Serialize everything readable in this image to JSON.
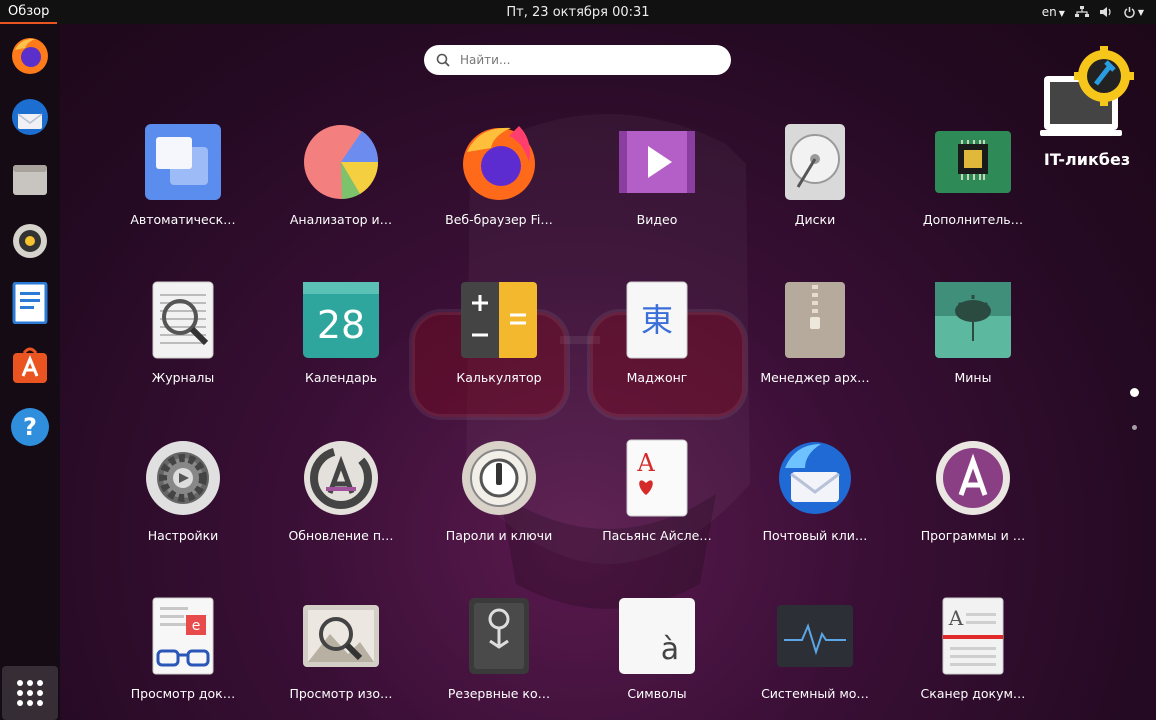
{
  "topbar": {
    "activities": "Обзор",
    "clock": "Пт, 23 октября  00:31",
    "lang": "en",
    "tray_icons": [
      "network-icon",
      "volume-icon",
      "power-icon"
    ]
  },
  "search": {
    "placeholder": "Найти..."
  },
  "dock": {
    "items": [
      "firefox-icon",
      "thunderbird-icon",
      "files-icon",
      "rhythmbox-icon",
      "writer-icon",
      "software-icon",
      "help-icon"
    ],
    "show_apps": "show-apps-grid-icon"
  },
  "apps": [
    {
      "label": "Автоматическ…",
      "icon": "automation-icon"
    },
    {
      "label": "Анализатор и…",
      "icon": "disk-usage-pie-icon"
    },
    {
      "label": "Веб-браузер Fi…",
      "icon": "firefox-icon"
    },
    {
      "label": "Видео",
      "icon": "video-play-icon"
    },
    {
      "label": "Диски",
      "icon": "disks-icon"
    },
    {
      "label": "Дополнитель…",
      "icon": "chip-icon"
    },
    {
      "label": "Журналы",
      "icon": "logs-magnifier-icon"
    },
    {
      "label": "Календарь",
      "icon": "calendar-icon",
      "day": "28"
    },
    {
      "label": "Калькулятор",
      "icon": "calculator-icon"
    },
    {
      "label": "Маджонг",
      "icon": "mahjong-icon",
      "glyph": "東"
    },
    {
      "label": "Менеджер арх…",
      "icon": "archive-manager-icon"
    },
    {
      "label": "Мины",
      "icon": "mines-icon"
    },
    {
      "label": "Настройки",
      "icon": "settings-gear-icon"
    },
    {
      "label": "Обновление п…",
      "icon": "software-updater-icon"
    },
    {
      "label": "Пароли и ключи",
      "icon": "passwords-keys-icon"
    },
    {
      "label": "Пасьянс Айсле…",
      "icon": "solitaire-card-icon",
      "glyph": "A"
    },
    {
      "label": "Почтовый кли…",
      "icon": "thunderbird-icon"
    },
    {
      "label": "Программы и …",
      "icon": "software-center-icon"
    },
    {
      "label": "Просмотр док…",
      "icon": "document-viewer-icon"
    },
    {
      "label": "Просмотр изо…",
      "icon": "image-viewer-icon"
    },
    {
      "label": "Резервные ко…",
      "icon": "backup-safe-icon"
    },
    {
      "label": "Символы",
      "icon": "characters-icon",
      "glyph": "à"
    },
    {
      "label": "Системный мо…",
      "icon": "system-monitor-icon"
    },
    {
      "label": "Сканер докум…",
      "icon": "document-scanner-icon",
      "glyph": "A"
    }
  ],
  "watermark": {
    "text": "IT-ликбез"
  },
  "colors": {
    "accent": "#e95420",
    "topbar": "#111111",
    "dock": "#140c14"
  },
  "pages": {
    "current": 1,
    "total": 2
  }
}
